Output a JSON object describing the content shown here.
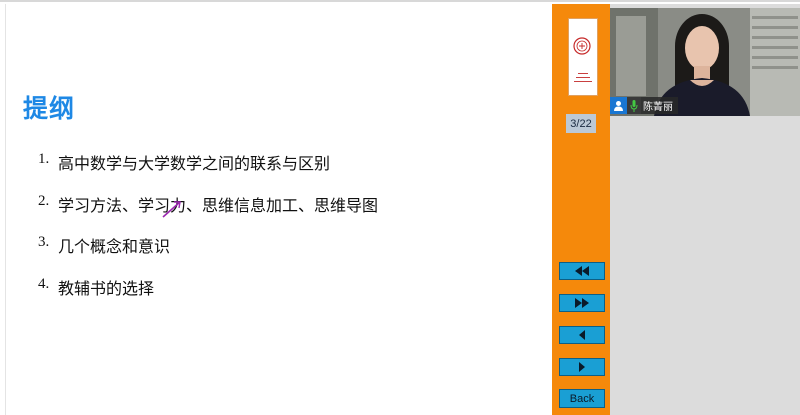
{
  "slide": {
    "title": "提纲",
    "items": [
      {
        "num": "1.",
        "text": "高中数学与大学数学之间的联系与区别"
      },
      {
        "num": "2.",
        "text": "学习方法、学习力、思维信息加工、思维导图"
      },
      {
        "num": "3.",
        "text": "几个概念和意识"
      },
      {
        "num": "4.",
        "text": "教辅书的选择"
      }
    ]
  },
  "navigation": {
    "page_indicator": "3/22",
    "buttons": [
      {
        "name": "first-page-button",
        "icon": "double-left-arrow-icon"
      },
      {
        "name": "last-page-button",
        "icon": "double-right-arrow-icon"
      },
      {
        "name": "previous-page-button",
        "icon": "left-arrow-icon"
      },
      {
        "name": "next-page-button",
        "icon": "right-arrow-icon"
      }
    ],
    "back_label": "Back"
  },
  "video": {
    "participant_name": "陈菁丽"
  },
  "colors": {
    "title": "#1e88e5",
    "nav_bar": "#f5890b",
    "nav_button": "#1a9fd4",
    "annotation": "#9c27b0"
  }
}
